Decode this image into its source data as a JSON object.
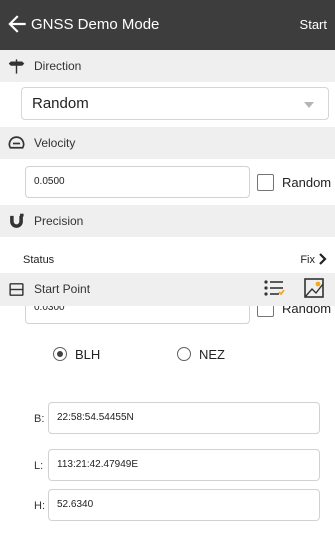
{
  "appbar": {
    "title": "GNSS Demo Mode",
    "action": "Start"
  },
  "direction": {
    "header": "Direction",
    "selected": "Random"
  },
  "velocity": {
    "header": "Velocity",
    "value": "0.0500",
    "random_label": "Random"
  },
  "precision": {
    "header": "Precision",
    "status_label": "Status",
    "status_value": "Fix",
    "value": "0.0300",
    "random_label": "Random"
  },
  "start_point": {
    "header": "Start Point",
    "mode_blh": "BLH",
    "mode_nez": "NEZ",
    "selected_mode": "BLH",
    "b_label": "B:",
    "b_value": "22:58:54.54455N",
    "l_label": "L:",
    "l_value": "113:21:42.47949E",
    "h_label": "H:",
    "h_value": "52.6340"
  },
  "icons": {
    "back": "arrow-left-icon",
    "direction": "signpost-icon",
    "velocity": "speedometer-icon",
    "precision": "magnet-icon",
    "start_point": "frame-icon",
    "point_list": "point-list-icon",
    "map_select": "map-select-icon",
    "status_next": "chevron-right-icon"
  },
  "colors": {
    "appbar": "#3d3d3d",
    "section": "#efefef",
    "accent_orange": "#f5a623"
  }
}
